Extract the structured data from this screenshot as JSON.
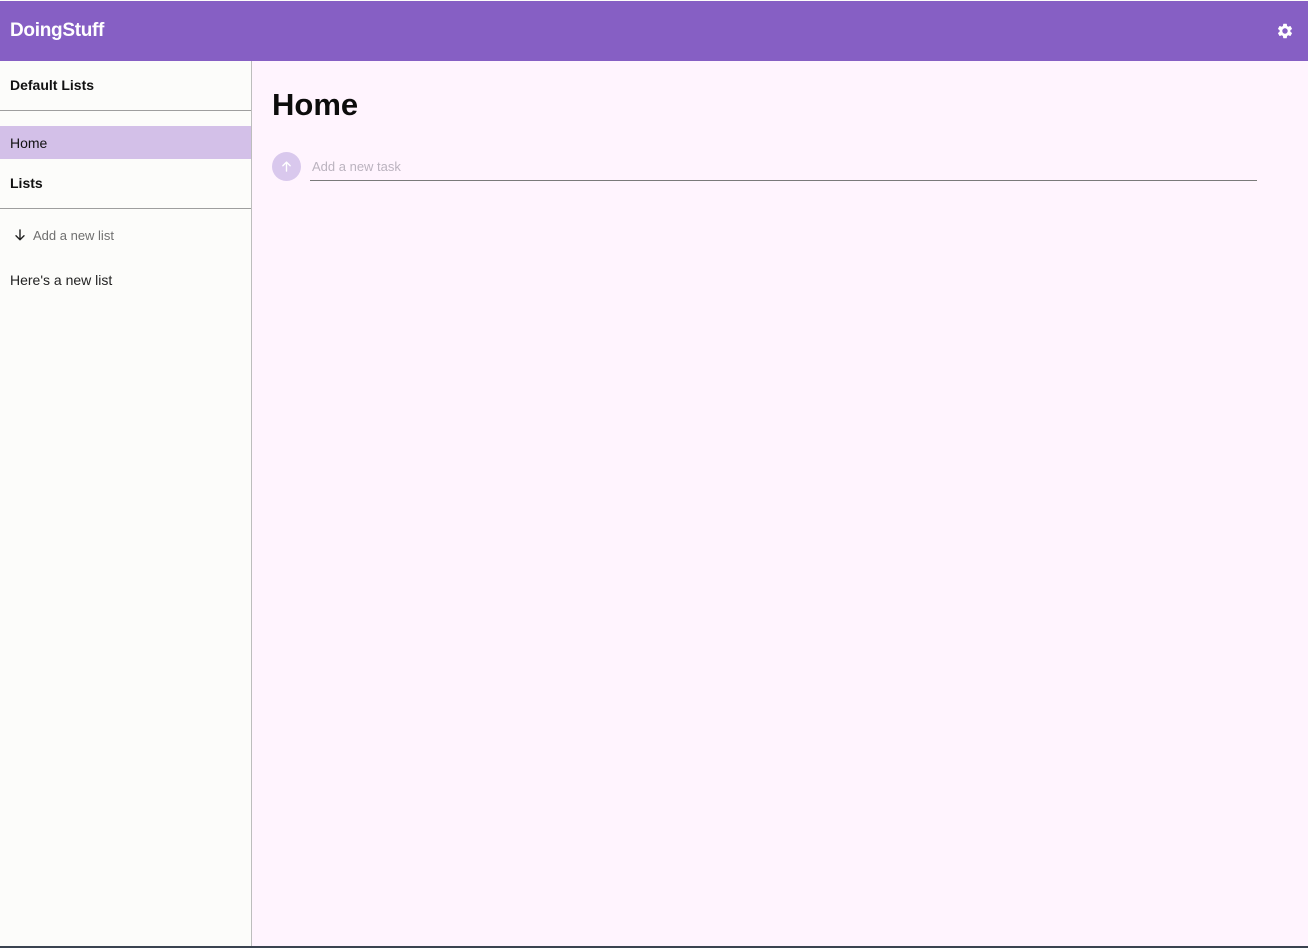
{
  "app": {
    "title": "DoingStuff"
  },
  "header": {
    "settings_icon": "gear-icon"
  },
  "sidebar": {
    "default_heading": "Default Lists",
    "default_items": [
      {
        "label": "Home",
        "active": true
      }
    ],
    "lists_heading": "Lists",
    "add_list": {
      "icon": "arrow-down-icon",
      "label": "Add a new list"
    },
    "lists": [
      {
        "label": "Here's a new list"
      }
    ]
  },
  "main": {
    "title": "Home",
    "task_input": {
      "icon": "arrow-up-icon",
      "placeholder": "Add a new task",
      "value": ""
    }
  },
  "colors": {
    "header": "#865fc4",
    "active_item": "#d3c0e8",
    "main_bg": "#fff4fe",
    "sidebar_bg": "#fcfcfa",
    "add_task_button": "#d9c8ed"
  }
}
